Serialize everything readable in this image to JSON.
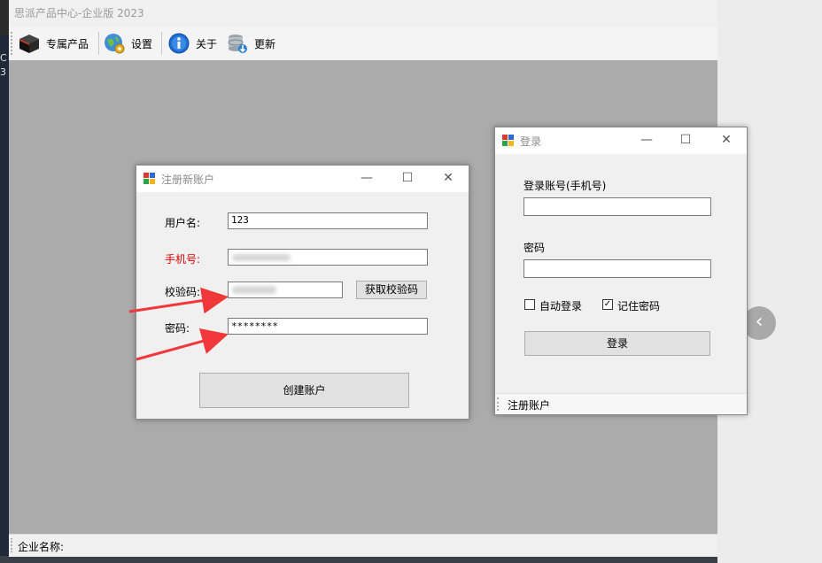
{
  "app": {
    "title": "思派产品中心-企业版 2023",
    "toolbar": [
      {
        "label": "专属产品",
        "icon": "red-box-icon"
      },
      {
        "label": "设置",
        "icon": "globe-gear-icon"
      },
      {
        "label": "关于",
        "icon": "info-icon"
      },
      {
        "label": "更新",
        "icon": "database-update-icon"
      }
    ],
    "status_label": "企业名称:"
  },
  "register": {
    "title": "注册新账户",
    "username_label": "用户名:",
    "username_value": "123",
    "phone_label": "手机号:",
    "code_label": "校验码:",
    "get_code_button": "获取校验码",
    "password_label": "密码:",
    "password_value": "********",
    "create_button": "创建账户"
  },
  "login": {
    "title": "登录",
    "account_label": "登录账号(手机号)",
    "password_label": "密码",
    "auto_login_label": "自动登录",
    "auto_login_checked": false,
    "remember_label": "记住密码",
    "remember_checked": true,
    "login_button": "登录",
    "register_link": "注册账户"
  },
  "desktop": {
    "left_edge_text": "C\n3",
    "nav_symbol": "‹"
  },
  "colors": {
    "mdi_background": "#ababab",
    "required_label": "#e00000",
    "annotation_arrow": "#f0383a"
  }
}
